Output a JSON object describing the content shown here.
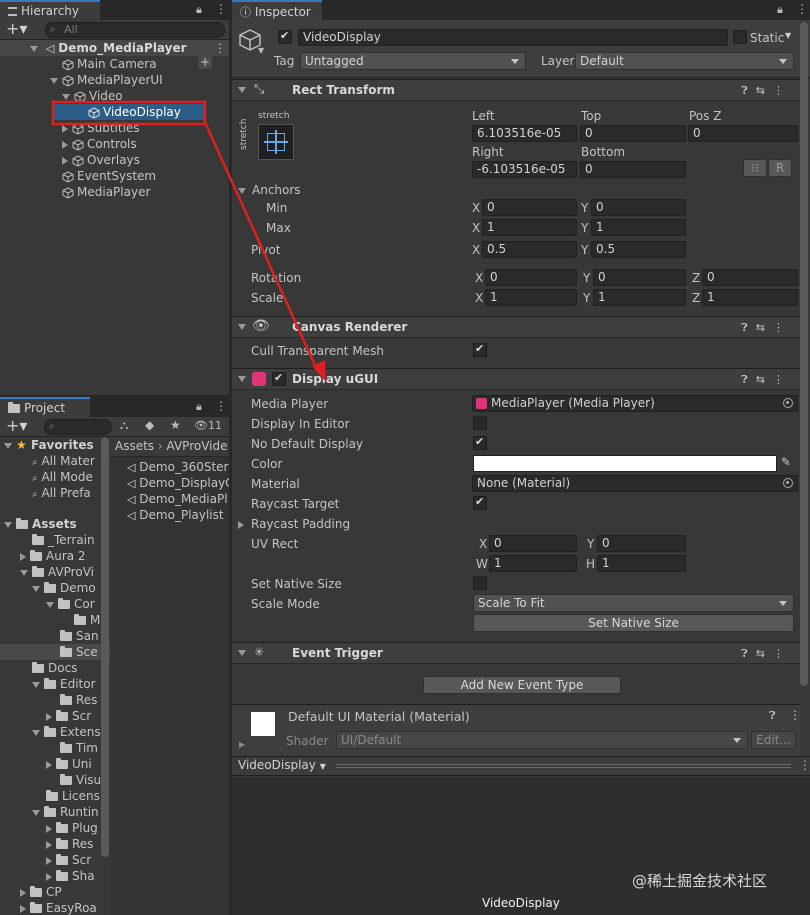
{
  "hierarchy": {
    "tab": "Hierarchy",
    "search_placeholder": "All",
    "items": [
      {
        "label": "Demo_MediaPlayer"
      },
      {
        "label": "Main Camera"
      },
      {
        "label": "MediaPlayerUI"
      },
      {
        "label": "Video"
      },
      {
        "label": "VideoDisplay"
      },
      {
        "label": "Subtitles"
      },
      {
        "label": "Controls"
      },
      {
        "label": "Overlays"
      },
      {
        "label": "EventSystem"
      },
      {
        "label": "MediaPlayer"
      }
    ]
  },
  "project": {
    "tab": "Project",
    "hidden_count": "11",
    "breadcrumb": [
      "Assets",
      "AVProVide"
    ],
    "favorites": {
      "label": "Favorites",
      "items": [
        "All Mater",
        "All Mode",
        "All Prefa"
      ]
    },
    "assets": {
      "label": "Assets"
    },
    "tree": [
      "_Terrain",
      "Aura 2",
      "AVProVi",
      "Demo",
      "Cor",
      "M",
      "San",
      "Sce",
      "Docs",
      "Editor",
      "Res",
      "Scr",
      "Extens",
      "Tim",
      "Uni",
      "Visu",
      "Licens",
      "Runtin",
      "Plug",
      "Res",
      "Scr",
      "Sha",
      "CP",
      "EasyRoa"
    ],
    "files": [
      "Demo_360Stere",
      "Demo_DisplayC",
      "Demo_MediaPl",
      "Demo_Playlist"
    ]
  },
  "inspector": {
    "tab": "Inspector",
    "object_name": "VideoDisplay",
    "static_label": "Static",
    "tag_label": "Tag",
    "tag_value": "Untagged",
    "layer_label": "Layer",
    "layer_value": "Default",
    "rect_transform": {
      "title": "Rect Transform",
      "anchor_preset": "stretch",
      "left_label": "Left",
      "left": "6.103516e-05",
      "top_label": "Top",
      "top": "0",
      "posz_label": "Pos Z",
      "posz": "0",
      "right_label": "Right",
      "right": "-6.103516e-05",
      "bottom_label": "Bottom",
      "bottom": "0",
      "r_button": "R",
      "anchors_label": "Anchors",
      "min_label": "Min",
      "min_x": "0",
      "min_y": "0",
      "max_label": "Max",
      "max_x": "1",
      "max_y": "1",
      "pivot_label": "Pivot",
      "pivot_x": "0.5",
      "pivot_y": "0.5",
      "rotation_label": "Rotation",
      "rot_x": "0",
      "rot_y": "0",
      "rot_z": "0",
      "scale_label": "Scale",
      "scale_x": "1",
      "scale_y": "1",
      "scale_z": "1"
    },
    "canvas_renderer": {
      "title": "Canvas Renderer",
      "cull_label": "Cull Transparent Mesh"
    },
    "display_ugui": {
      "title": "Display uGUI",
      "media_player_label": "Media Player",
      "media_player_value": "MediaPlayer (Media Player)",
      "display_in_editor_label": "Display In Editor",
      "no_default_display_label": "No Default Display",
      "color_label": "Color",
      "material_label": "Material",
      "material_value": "None (Material)",
      "raycast_target_label": "Raycast Target",
      "raycast_padding_label": "Raycast Padding",
      "uv_rect_label": "UV Rect",
      "uv_x": "0",
      "uv_y": "0",
      "uv_w": "1",
      "uv_h": "1",
      "set_native_size_label": "Set Native Size",
      "scale_mode_label": "Scale Mode",
      "scale_mode_value": "Scale To Fit",
      "set_native_size_button": "Set Native Size"
    },
    "event_trigger": {
      "title": "Event Trigger",
      "add_button": "Add New Event Type"
    },
    "material": {
      "title": "Default UI Material (Material)",
      "shader_label": "Shader",
      "shader_value": "UI/Default",
      "edit_button": "Edit..."
    },
    "preview": {
      "dropdown": "VideoDisplay",
      "caption": "VideoDisplay"
    },
    "axis": {
      "x": "X",
      "y": "Y",
      "z": "Z",
      "w": "W",
      "h": "H"
    }
  },
  "watermark": "@稀土掘金技术社区",
  "colors": {
    "selection": "#2c5d87",
    "tab_accent": "#3a79bb",
    "annotation": "#e0201e"
  }
}
